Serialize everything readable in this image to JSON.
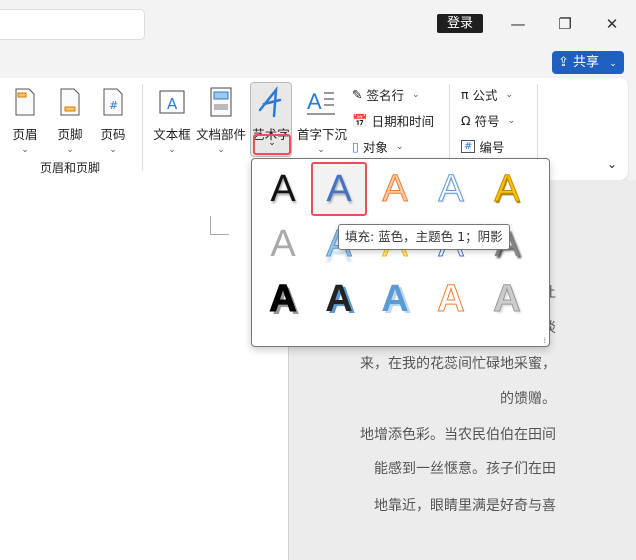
{
  "titlebar": {
    "login": "登录",
    "minimize": "—",
    "restore": "❐",
    "close": "✕"
  },
  "share": {
    "label": "共享",
    "icon": "share-icon"
  },
  "ribbon": {
    "header": "页眉",
    "footer": "页脚",
    "page_number": "页码",
    "group_header_footer": "页眉和页脚",
    "textbox": "文本框",
    "quick_parts": "文档部件",
    "wordart": "艺术字",
    "drop_cap": "首字下沉",
    "signature_line": "签名行",
    "date_time": "日期和时间",
    "object": "对象",
    "equation": "公式",
    "symbol": "符号",
    "numbering": "编号"
  },
  "document": {
    "lines": [
      "。",
      "我会舒展自己娇嫩的花瓣，让",
      "拂，我轻轻摇曳，散发出淡淡",
      "来，在我的花蕊间忙碌地采蜜，",
      "的馈赠。",
      "地增添色彩。当农民伯伯在田间",
      "能感到一丝惬意。孩子们在田",
      "地靠近，眼睛里满是好奇与喜"
    ]
  },
  "gallery": {
    "selected_index": 1,
    "tooltip": "填充: 蓝色，主题色 1；阴影",
    "glyph": "A",
    "styles": [
      {
        "fill": "#111",
        "stroke": "none",
        "shadow": "1px 2px 2px rgba(0,0,0,.35)"
      },
      {
        "fill": "#4472c4",
        "stroke": "none",
        "shadow": "1px 2px 2px rgba(0,0,0,.3)"
      },
      {
        "fill": "#f8cbad",
        "stroke": "#ed7d31",
        "shadow": "none"
      },
      {
        "fill": "#fff",
        "stroke": "#5b9bd5",
        "shadow": "1px 1px 2px rgba(0,0,0,.2)"
      },
      {
        "fill": "#ffc000",
        "stroke": "#bf9000",
        "shadow": "1px 2px 1px #a07800"
      },
      {
        "fill": "#aaa",
        "stroke": "none",
        "shadow": "none"
      },
      {
        "fill": "#9dc3e6",
        "stroke": "#5b9bd5",
        "shadow": "0 6px 2px rgba(91,155,213,.3)"
      },
      {
        "fill": "#ffe699",
        "stroke": "#ffc000",
        "shadow": "none"
      },
      {
        "fill": "#fff",
        "stroke": "#4472c4",
        "shadow": "none"
      },
      {
        "fill": "#888",
        "stroke": "none",
        "shadow": "2px 2px 2px #444"
      },
      {
        "fill": "#000",
        "stroke": "#000",
        "shadow": "3px 3px 0 #999"
      },
      {
        "fill": "#222",
        "stroke": "none",
        "shadow": "3px 2px 0 #5b9bd5"
      },
      {
        "fill": "#5b9bd5",
        "stroke": "none",
        "shadow": "3px 2px 0 #bdd7ee"
      },
      {
        "fill": "#fff",
        "stroke": "#ed7d31",
        "shadow": "none"
      },
      {
        "fill": "#ccc",
        "stroke": "#999",
        "shadow": "2px 2px 2px #ddd"
      }
    ]
  }
}
